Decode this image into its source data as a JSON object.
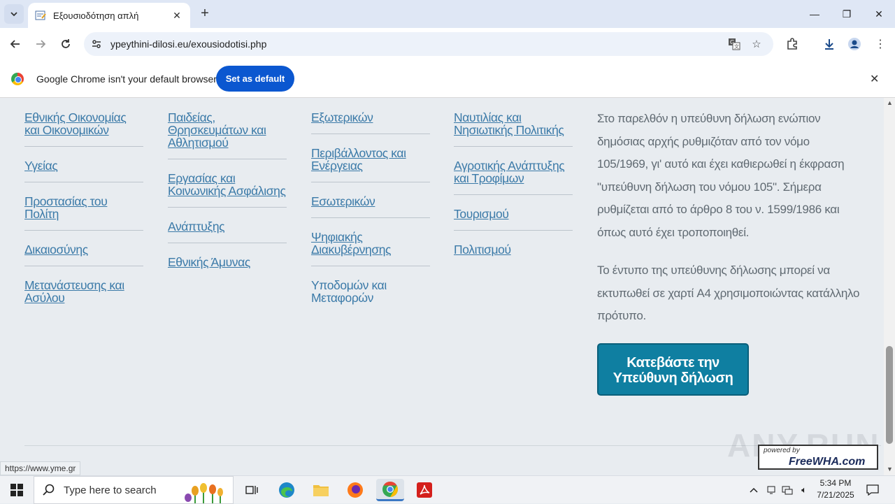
{
  "browser": {
    "tab_title": "Εξουσιοδότηση απλή",
    "url": "ypeythini-dilosi.eu/exousiodotisi.php",
    "infobar_message": "Google Chrome isn't your default browser",
    "set_default_label": "Set as default"
  },
  "content": {
    "columns": [
      [
        "Εθνικής Οικονομίας και Οικονομικών",
        "Υγείας",
        "Προστασίας του Πολίτη",
        "Δικαιοσύνης",
        "Μετανάστευσης και Ασύλου"
      ],
      [
        "Παιδείας, Θρησκευμάτων και Αθλητισμού",
        "Εργασίας και Κοινωνικής Ασφάλισης",
        "Ανάπτυξης",
        "Εθνικής Άμυνας"
      ],
      [
        "Εξωτερικών",
        "Περιβάλλοντος και Ενέργειας",
        "Εσωτερικών",
        "Ψηφιακής Διακυβέρνησης",
        "Υποδομών και Μεταφορών"
      ],
      [
        "Ναυτιλίας και Νησιωτικής Πολιτικής",
        "Αγροτικής Ανάπτυξης και Τροφίμων",
        "Τουρισμού",
        "Πολιτισμού"
      ]
    ],
    "paragraph_1": "Στο παρελθόν η υπεύθυνη δήλωση ενώπιον δημόσιας αρχής ρυθμιζόταν από τον νόμο 105/1969, γι' αυτό και έχει καθιερωθεί η έκφραση \"υπεύθυνη δήλωση του νόμου 105\". Σήμερα ρυθμίζεται από το άρθρο 8 του ν. 1599/1986 και όπως αυτό έχει τροποποιηθεί.",
    "paragraph_2": "Το έντυπο της υπεύθυνης δήλωσης μπορεί να εκτυπωθεί σε χαρτί A4 χρησιμοποιώντας κατάλληλο πρότυπο.",
    "download_button": "Κατεβάστε την Υπεύθυνη δήλωση",
    "status_url": "https://www.yme.gr",
    "watermark": "ANY.RUN",
    "badge_small": "powered by",
    "badge_brand": "FreeWHA.com"
  },
  "taskbar": {
    "search_placeholder": "Type here to search",
    "time": "5:34 PM",
    "date": "7/21/2025"
  }
}
